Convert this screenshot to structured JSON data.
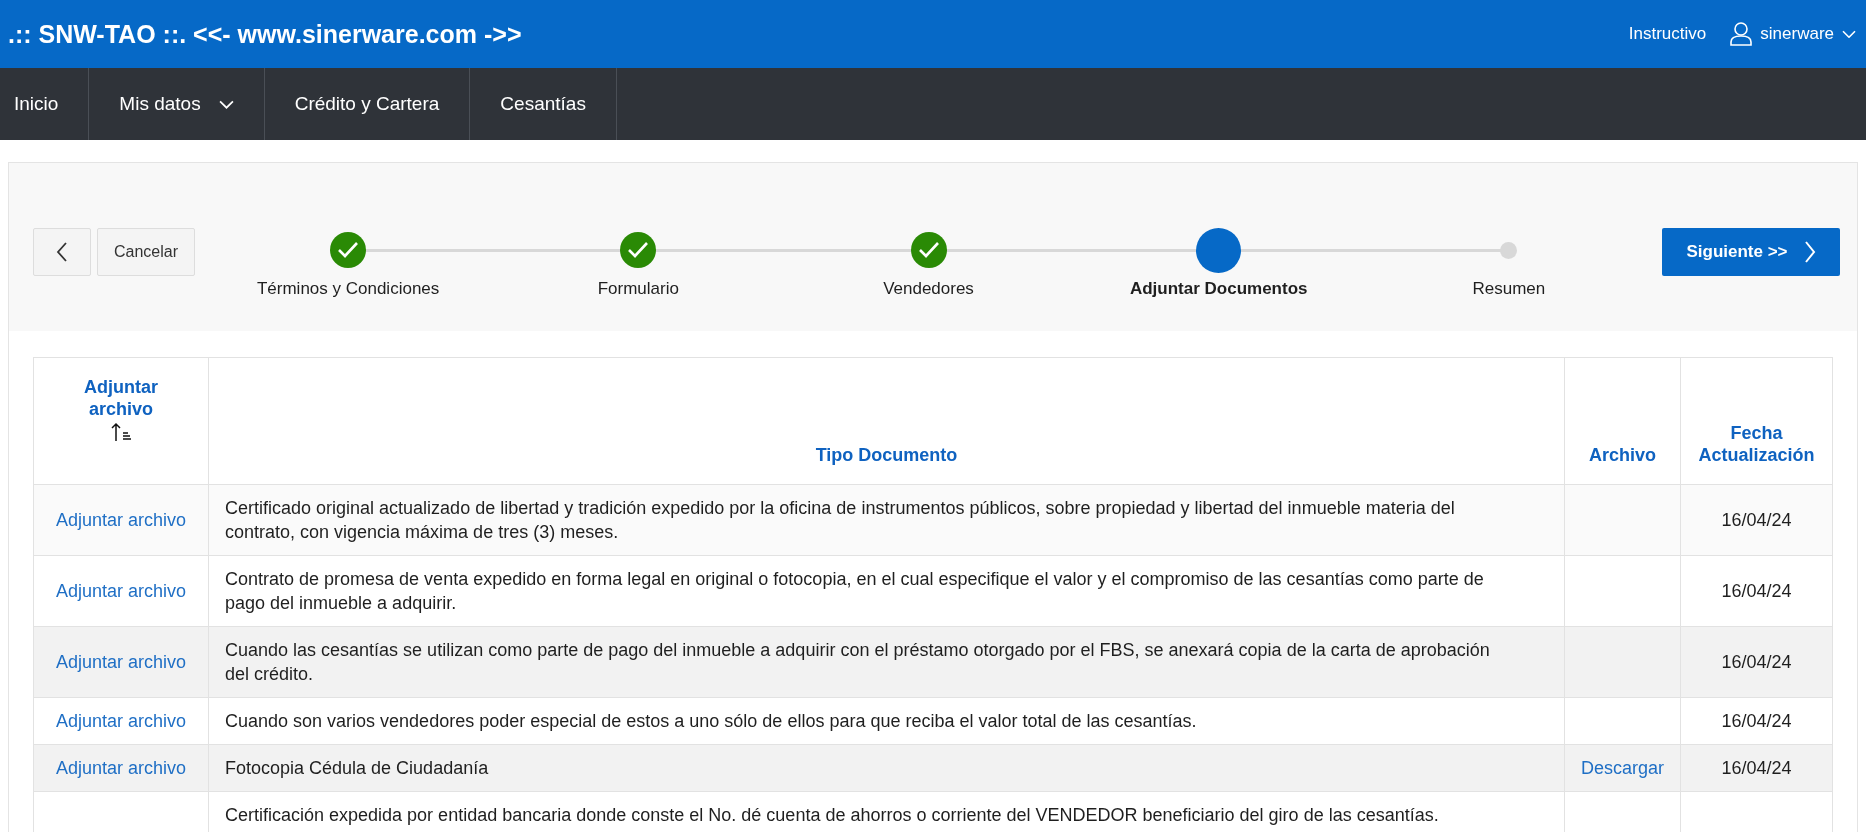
{
  "header": {
    "title": ".:: SNW-TAO ::. <<- www.sinerware.com ->>",
    "links": [
      {
        "label": "Instructivo"
      }
    ],
    "user": {
      "name": "sinerware"
    }
  },
  "nav": [
    {
      "label": "Inicio",
      "dropdown": false
    },
    {
      "label": "Mis datos",
      "dropdown": true
    },
    {
      "label": "Crédito y Cartera",
      "dropdown": false
    },
    {
      "label": "Cesantías",
      "dropdown": false
    }
  ],
  "wizard": {
    "cancel_label": "Cancelar",
    "next_label": "Siguiente >>",
    "steps": [
      {
        "label": "Términos y Condiciones",
        "completed": true,
        "selected": false
      },
      {
        "label": "Formulario",
        "completed": true,
        "selected": false
      },
      {
        "label": "Vendedores",
        "completed": true,
        "selected": false
      },
      {
        "label": "Adjuntar Documentos",
        "completed": false,
        "selected": true
      },
      {
        "label": "Resumen",
        "completed": false,
        "selected": false
      }
    ]
  },
  "table": {
    "columns": [
      {
        "label": "Adjuntar archivo",
        "sorted": true
      },
      {
        "label": "Tipo Documento",
        "sorted": false
      },
      {
        "label": "Archivo",
        "sorted": false
      },
      {
        "label": "Fecha Actualización",
        "sorted": false
      }
    ],
    "rows": [
      {
        "action": "Adjuntar archivo",
        "tipo_documento": "Certificado original actualizado de libertad y tradición expedido por la oficina de instrumentos públicos, sobre propiedad y libertad del inmueble materia del contrato, con vigencia máxima de tres (3) meses.",
        "fecha": "16/04/24"
      },
      {
        "action": "Adjuntar archivo",
        "tipo_documento": "Contrato de promesa de venta expedido en forma legal en original o fotocopia, en el cual especifique el valor y el compromiso de las cesantías como parte de pago del inmueble a adquirir.",
        "fecha": "16/04/24"
      },
      {
        "action": "Adjuntar archivo",
        "tipo_documento": "Cuando las cesantías se utilizan como parte de pago del inmueble a adquirir con el préstamo otorgado por el FBS, se anexará copia de la carta de aprobación del crédito.",
        "fecha": "16/04/24"
      },
      {
        "action": "Adjuntar archivo",
        "tipo_documento": "Cuando son varios vendedores poder especial de estos a uno sólo de ellos para que reciba el valor total de las cesantías.",
        "fecha": "16/04/24"
      },
      {
        "action": "Adjuntar archivo",
        "tipo_documento": "Fotocopia Cédula de Ciudadanía",
        "archivo": "Descargar",
        "fecha": "16/04/24"
      },
      {
        "tipo_documento": "Certificación expedida por entidad bancaria donde conste el No. dé cuenta de ahorros o corriente del VENDEDOR beneficiario del giro de las cesantías."
      }
    ]
  }
}
